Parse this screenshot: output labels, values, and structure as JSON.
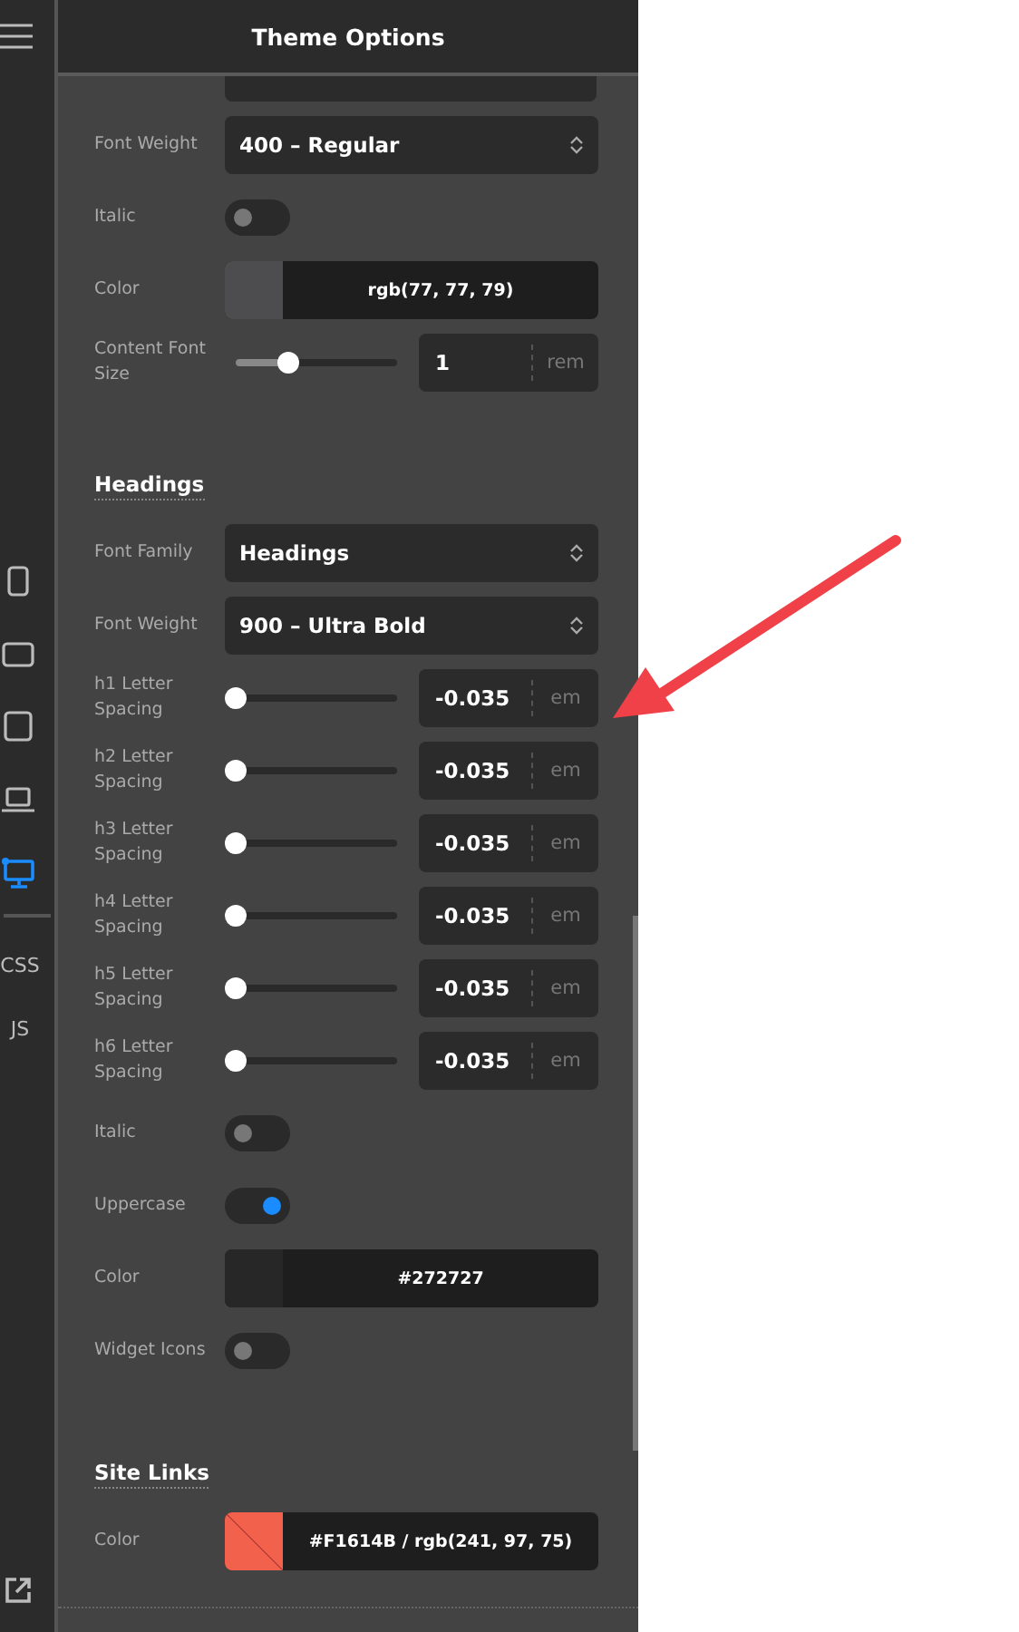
{
  "header": {
    "title": "Theme Options"
  },
  "rail": {
    "devices": [
      {
        "selected": false
      },
      {
        "selected": false
      },
      {
        "selected": false
      },
      {
        "selected": false
      },
      {
        "selected": true
      }
    ],
    "code_links": [
      "CSS",
      "JS"
    ]
  },
  "sections": [
    {
      "cut_top": true,
      "rows": [
        {
          "kind": "select",
          "label": "Font Weight",
          "value": "400 – Regular"
        },
        {
          "kind": "toggle",
          "label": "Italic",
          "on": false
        },
        {
          "kind": "color",
          "label": "Color",
          "value": "rgb(77, 77, 79)",
          "color": "#4d4d4f"
        },
        {
          "kind": "slider",
          "label": "Content Font Size",
          "level": 0.33,
          "value": "1",
          "unit": "rem"
        }
      ]
    },
    {
      "title": "Headings",
      "rows": [
        {
          "kind": "select",
          "label": "Font Family",
          "value": "Headings"
        },
        {
          "kind": "select",
          "label": "Font Weight",
          "value": "900 – Ultra Bold"
        },
        {
          "kind": "slider",
          "label": "h1 Letter Spacing",
          "level": 0,
          "value": "-0.035",
          "unit": "em"
        },
        {
          "kind": "slider",
          "label": "h2 Letter Spacing",
          "level": 0,
          "value": "-0.035",
          "unit": "em"
        },
        {
          "kind": "slider",
          "label": "h3 Letter Spacing",
          "level": 0,
          "value": "-0.035",
          "unit": "em"
        },
        {
          "kind": "slider",
          "label": "h4 Letter Spacing",
          "level": 0,
          "value": "-0.035",
          "unit": "em"
        },
        {
          "kind": "slider",
          "label": "h5 Letter Spacing",
          "level": 0,
          "value": "-0.035",
          "unit": "em"
        },
        {
          "kind": "slider",
          "label": "h6 Letter Spacing",
          "level": 0,
          "value": "-0.035",
          "unit": "em"
        },
        {
          "kind": "toggle",
          "label": "Italic",
          "on": false
        },
        {
          "kind": "toggle",
          "label": "Uppercase",
          "on": true
        },
        {
          "kind": "color",
          "label": "Color",
          "value": "#272727",
          "color": "#272727"
        },
        {
          "kind": "toggle",
          "label": "Widget Icons",
          "on": false
        }
      ]
    },
    {
      "title": "Site Links",
      "rows": [
        {
          "kind": "color",
          "label": "Color",
          "value": "#F1614B / rgb(241, 97, 75)",
          "color": "#f1614b",
          "slashed": true
        }
      ]
    }
  ]
}
